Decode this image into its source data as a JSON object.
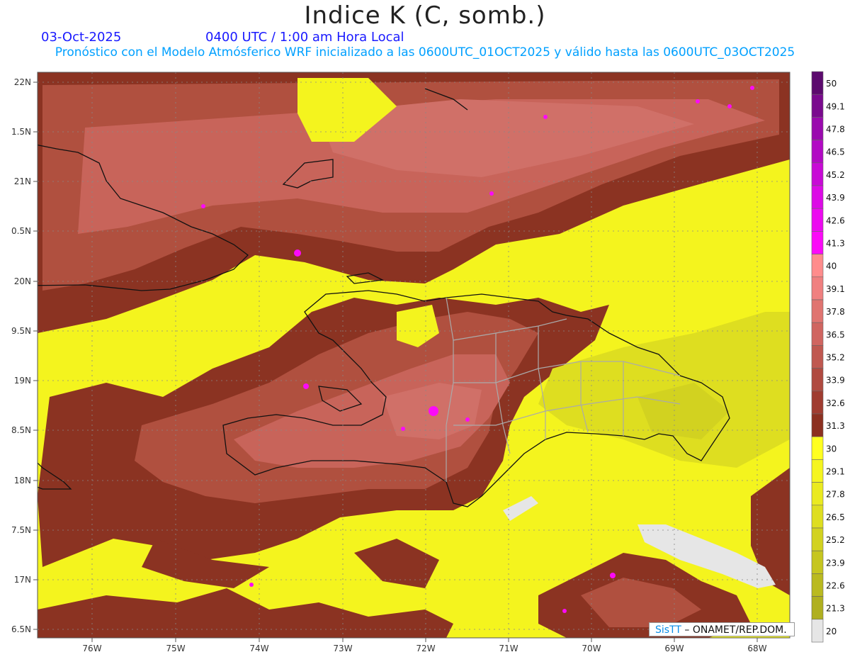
{
  "header": {
    "title": "Indice K (C, somb.)",
    "date": "03-Oct-2025",
    "time": "0400 UTC / 1:00 am Hora Local",
    "subtitle": "Pronóstico con el Modelo Atmósferico WRF inicializado a las 0600UTC_01OCT2025 y válido hasta las  0600UTC_03OCT2025"
  },
  "axes": {
    "lat_labels": [
      "22N",
      "1.5N",
      "21N",
      "0.5N",
      "20N",
      "9.5N",
      "19N",
      "8.5N",
      "18N",
      "7.5N",
      "17N",
      "6.5N"
    ],
    "lon_labels": [
      "76W",
      "75W",
      "74W",
      "73W",
      "72W",
      "71W",
      "70W",
      "69W",
      "68W"
    ]
  },
  "colorbar": {
    "labels": [
      "50",
      "49.1",
      "47.8",
      "46.5",
      "45.2",
      "43.9",
      "42.6",
      "41.3",
      "40",
      "39.1",
      "37.8",
      "36.5",
      "35.2",
      "33.9",
      "32.6",
      "31.3",
      "30",
      "29.1",
      "27.8",
      "26.5",
      "25.2",
      "23.9",
      "22.6",
      "21.3",
      "20"
    ],
    "colors": [
      "#5c0a6e",
      "#7a0a8e",
      "#9a0aae",
      "#b20ac4",
      "#c80ad6",
      "#dc0ae6",
      "#ec0af0",
      "#fb0af8",
      "#ff8c8c",
      "#f08080",
      "#e07470",
      "#d06560",
      "#c05850",
      "#b04a40",
      "#a03c30",
      "#8c3020",
      "#ffff20",
      "#f5f520",
      "#eaea20",
      "#dede20",
      "#d2d220",
      "#c6c620",
      "#babA20",
      "#b0b020",
      "#e6e6e6"
    ]
  },
  "credit": {
    "brand": "SisTT",
    "text": " – ONAMET/REP.DOM."
  }
}
